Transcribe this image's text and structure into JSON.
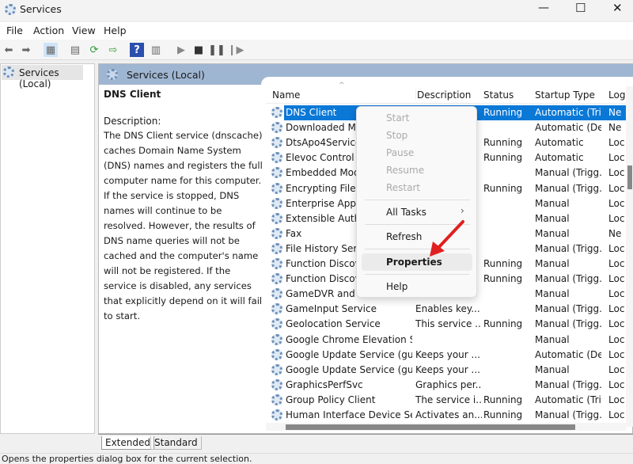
{
  "window": {
    "title": "Services",
    "controls": [
      "minimize",
      "maximize",
      "close"
    ]
  },
  "menu": [
    "File",
    "Action",
    "View",
    "Help"
  ],
  "toolbar": [
    "back",
    "forward",
    "show-hide-console-tree",
    "properties",
    "refresh",
    "export-list",
    "help",
    "show-hide-action-pane",
    "start-service",
    "stop-service",
    "pause-service",
    "restart-service"
  ],
  "tree": {
    "item": "Services (Local)"
  },
  "pane": {
    "header": "Services (Local)",
    "selected_name": "DNS Client",
    "desc_label": "Description:",
    "description": "The DNS Client service (dnscache) caches Domain Name System (DNS) names and registers the full computer name for this computer. If the service is stopped, DNS names will continue to be resolved. However, the results of DNS name queries will not be cached and the computer's name will not be registered. If the service is disabled, any services that explicitly depend on it will fail to start."
  },
  "columns": [
    "Name",
    "Description",
    "Status",
    "Startup Type",
    "Log"
  ],
  "rows": [
    [
      "DNS Client",
      "",
      "Running",
      "Automatic (Tri...",
      "Ne"
    ],
    [
      "Downloaded Map",
      "",
      "",
      "Automatic (De...",
      "Ne"
    ],
    [
      "DtsApo4Service",
      "",
      "Running",
      "Automatic",
      "Loc"
    ],
    [
      "Elevoc Control Se",
      "",
      "Running",
      "Automatic",
      "Loc"
    ],
    [
      "Embedded Mode",
      "",
      "",
      "Manual (Trigg...",
      "Loc"
    ],
    [
      "Encrypting File Sy",
      "",
      "Running",
      "Manual (Trigg...",
      "Loc"
    ],
    [
      "Enterprise App M",
      "",
      "",
      "Manual",
      "Loc"
    ],
    [
      "Extensible Authen",
      "",
      "",
      "Manual",
      "Loc"
    ],
    [
      "Fax",
      "",
      "",
      "Manual",
      "Ne"
    ],
    [
      "File History Servic",
      "",
      "",
      "Manual (Trigg...",
      "Loc"
    ],
    [
      "Function Discove",
      "",
      "Running",
      "Manual",
      "Loc"
    ],
    [
      "Function Discove",
      "",
      "Running",
      "Manual (Trigg...",
      "Loc"
    ],
    [
      "GameDVR and Br",
      "",
      "",
      "Manual",
      "Loc"
    ],
    [
      "GameInput Service",
      "Enables key...",
      "",
      "Manual (Trigg...",
      "Loc"
    ],
    [
      "Geolocation Service",
      "This service ...",
      "Running",
      "Manual (Trigg...",
      "Loc"
    ],
    [
      "Google Chrome Elevation Se...",
      "",
      "",
      "Manual",
      "Loc"
    ],
    [
      "Google Update Service (gup...",
      "Keeps your ...",
      "",
      "Automatic (De...",
      "Loc"
    ],
    [
      "Google Update Service (gup...",
      "Keeps your ...",
      "",
      "Manual",
      "Loc"
    ],
    [
      "GraphicsPerfSvc",
      "Graphics per...",
      "",
      "Manual (Trigg...",
      "Loc"
    ],
    [
      "Group Policy Client",
      "The service i...",
      "Running",
      "Automatic (Tri...",
      "Loc"
    ],
    [
      "Human Interface Device Serv...",
      "Activates an...",
      "Running",
      "Manual (Trigg...",
      "Loc"
    ]
  ],
  "context_menu": {
    "start": "Start",
    "stop": "Stop",
    "pause": "Pause",
    "resume": "Resume",
    "restart": "Restart",
    "all_tasks": "All Tasks",
    "refresh": "Refresh",
    "properties": "Properties",
    "help": "Help"
  },
  "tabs": [
    "Extended",
    "Standard"
  ],
  "statusbar": "Opens the properties dialog box for the current selection.",
  "colors": {
    "selection": "#0a78d7",
    "header_band": "#9fb6d2",
    "arrow": "#e02020"
  }
}
